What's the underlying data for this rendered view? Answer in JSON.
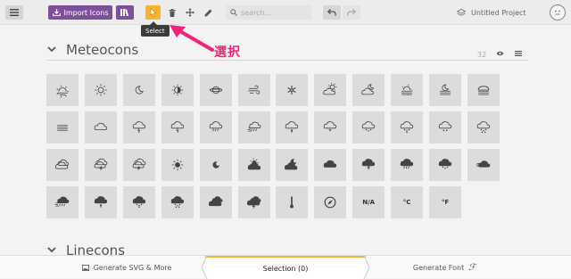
{
  "toolbar": {
    "menu_icon": "hamburger-icon",
    "import_label": "Import Icons",
    "search_placeholder": "search...",
    "project_name": "Untitled Project",
    "accent_purple": "#7e4f9a",
    "accent_orange": "#f8b332"
  },
  "tooltip": {
    "text": "Select"
  },
  "annotation": {
    "text": "選択",
    "color": "#f4227a"
  },
  "sets": [
    {
      "title": "Meteocons",
      "count": "32"
    },
    {
      "title": "Linecons"
    }
  ],
  "icons": [
    "sunrise",
    "sun",
    "moon",
    "sun-half",
    "planet",
    "wind",
    "snowflake",
    "cloud-sun",
    "cloud-moon",
    "fog-sun",
    "fog-moon",
    "fog-cloud",
    "fog",
    "cloud",
    "cloud-lightning",
    "cloud-lightning-2",
    "cloud-rain",
    "cloud-wind-rain",
    "cloud-sleet",
    "cloud-drizzle",
    "cloud-snow",
    "cloud-snow-2",
    "cloud-hail",
    "cloud-snow-3",
    "cloud-fill-outline",
    "cloud-lightning-3",
    "cloud-lightning-4",
    "sun-filled",
    "moon-filled",
    "cloud-sun-filled",
    "cloud-moon-filled",
    "cloud-filled",
    "cloud-lightning-filled",
    "cloud-rain-filled",
    "cloud-snow-filled",
    "cloud-wind-filled",
    "cloud-wind-rain-filled",
    "cloud-sleet-filled",
    "cloud-drizzle-filled",
    "cloud-snow-filled-2",
    "clouds-filled",
    "clouds-lightning-filled",
    "thermometer",
    "compass",
    "na",
    "celsius",
    "fahrenheit"
  ],
  "icon_text": {
    "na": "N/A",
    "celsius": "°C",
    "fahrenheit": "°F"
  },
  "bottombar": {
    "generate_svg": "Generate SVG & More",
    "selection": "Selection (0)",
    "generate_font": "Generate Font"
  }
}
